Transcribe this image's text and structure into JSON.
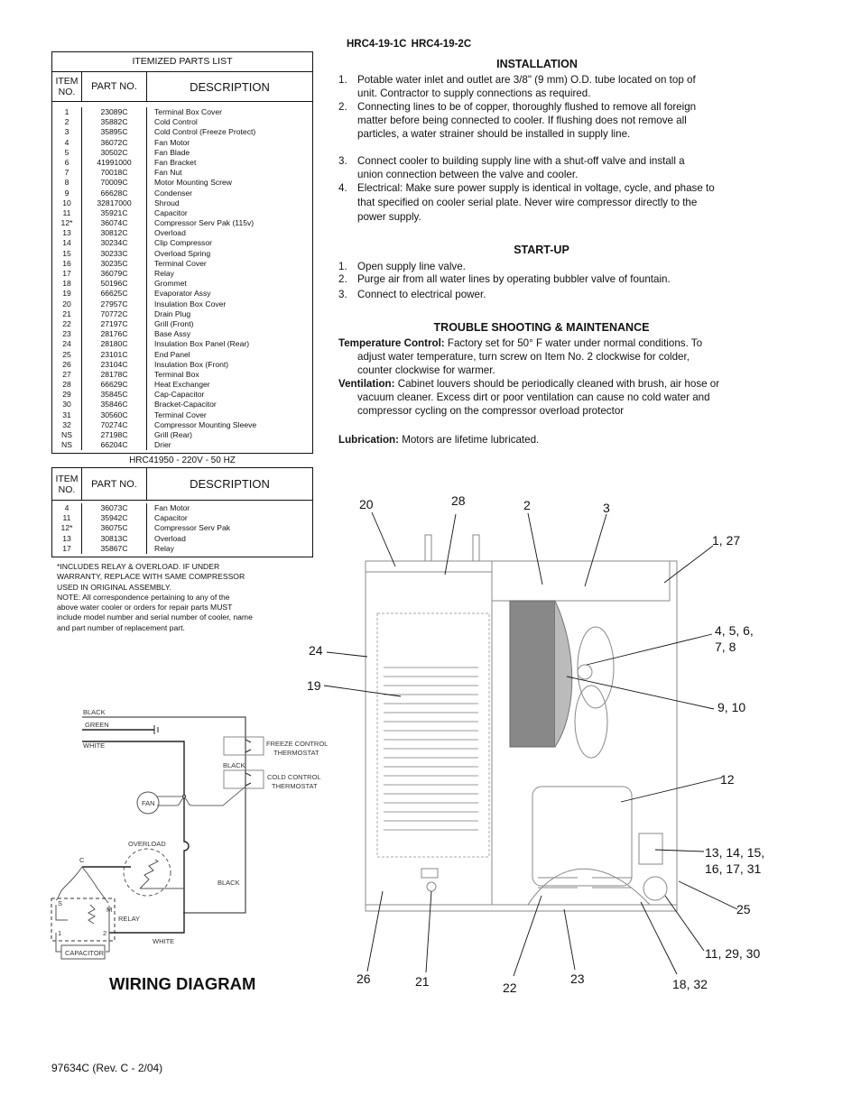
{
  "header": {
    "models": "HRC4-19-1C    HRC4-19-2C"
  },
  "parts_list": {
    "title": "ITEMIZED PARTS LIST",
    "columns": {
      "item": "ITEM NO.",
      "part": "PART  NO.",
      "desc": "DESCRIPTION"
    },
    "rows": [
      {
        "item": "1",
        "part": "23089C",
        "desc": "Terminal Box Cover"
      },
      {
        "item": "2",
        "part": "35882C",
        "desc": "Cold Control"
      },
      {
        "item": "3",
        "part": "35895C",
        "desc": "Cold Control (Freeze Protect)"
      },
      {
        "item": "4",
        "part": "36072C",
        "desc": "Fan Motor"
      },
      {
        "item": "5",
        "part": "30502C",
        "desc": "Fan Blade"
      },
      {
        "item": "6",
        "part": "41991000",
        "desc": "Fan Bracket"
      },
      {
        "item": "7",
        "part": "70018C",
        "desc": "Fan Nut"
      },
      {
        "item": "8",
        "part": "70009C",
        "desc": "Motor Mounting Screw"
      },
      {
        "item": "9",
        "part": "66628C",
        "desc": "Condenser"
      },
      {
        "item": "10",
        "part": "32817000",
        "desc": "Shroud"
      },
      {
        "item": "11",
        "part": "35921C",
        "desc": "Capacitor"
      },
      {
        "item": "12*",
        "part": "36074C",
        "desc": "Compressor Serv Pak (115v)"
      },
      {
        "item": "13",
        "part": "30812C",
        "desc": "Overload"
      },
      {
        "item": "14",
        "part": "30234C",
        "desc": "Clip Compressor"
      },
      {
        "item": "15",
        "part": "30233C",
        "desc": "Overload  Spring"
      },
      {
        "item": "16",
        "part": "30235C",
        "desc": "Terminal Cover"
      },
      {
        "item": "17",
        "part": "36079C",
        "desc": "Relay"
      },
      {
        "item": "18",
        "part": "50196C",
        "desc": "Grommet"
      },
      {
        "item": "19",
        "part": "66625C",
        "desc": "Evaporator Assy"
      },
      {
        "item": "20",
        "part": "27957C",
        "desc": "Insulation  Box Cover"
      },
      {
        "item": "21",
        "part": "70772C",
        "desc": "Drain  Plug"
      },
      {
        "item": "22",
        "part": "27197C",
        "desc": "Grill  (Front)"
      },
      {
        "item": "23",
        "part": "28176C",
        "desc": "Base Assy"
      },
      {
        "item": "24",
        "part": "28180C",
        "desc": "Insulation  Box  Panel  (Rear)"
      },
      {
        "item": "25",
        "part": "23101C",
        "desc": "End  Panel"
      },
      {
        "item": "26",
        "part": "23104C",
        "desc": "Insulation  Box  (Front)"
      },
      {
        "item": "27",
        "part": "28178C",
        "desc": "Terminal Box"
      },
      {
        "item": "28",
        "part": "66629C",
        "desc": "Heat Exchanger"
      },
      {
        "item": "29",
        "part": "35845C",
        "desc": "Cap-Capacitor"
      },
      {
        "item": "30",
        "part": "35846C",
        "desc": "Bracket-Capacitor"
      },
      {
        "item": "31",
        "part": "30560C",
        "desc": "Terminal Cover"
      },
      {
        "item": "32",
        "part": "70274C",
        "desc": "Compressor Mounting Sleeve"
      },
      {
        "item": "NS",
        "part": "27198C",
        "desc": "Grill  (Rear)"
      },
      {
        "item": "NS",
        "part": "66204C",
        "desc": "Drier"
      }
    ]
  },
  "alt_parts_list": {
    "title": "HRC41950 - 220V - 50 HZ",
    "columns": {
      "item": "ITEM NO.",
      "part": "PART  NO.",
      "desc": "DESCRIPTION"
    },
    "rows": [
      {
        "item": "4",
        "part": "36073C",
        "desc": "Fan Motor"
      },
      {
        "item": "11",
        "part": "35942C",
        "desc": "Capacitor"
      },
      {
        "item": "12*",
        "part": "36075C",
        "desc": "Compressor Serv Pak"
      },
      {
        "item": "13",
        "part": "30813C",
        "desc": "Overload"
      },
      {
        "item": "17",
        "part": "35867C",
        "desc": "Relay"
      }
    ]
  },
  "footnote": [
    "*INCLUDES RELAY & OVERLOAD.  IF UNDER",
    "WARRANTY, REPLACE WITH SAME COMPRESSOR",
    "USED IN ORIGINAL ASSEMBLY.",
    "NOTE:  All correspondence pertaining to any of the",
    "above water cooler or orders for repair parts MUST",
    "include model number and serial number of cooler, name",
    "and part number of replacement part."
  ],
  "installation": {
    "heading": "INSTALLATION",
    "items": [
      {
        "num": "1.",
        "text": "Potable water inlet and outlet are 3/8\" (9 mm) O.D. tube located on top of unit.  Contractor to supply connections as required."
      },
      {
        "num": "2.",
        "text": "Connecting lines to be of copper, thoroughly flushed to remove all foreign matter before being connected to cooler.  If flushing does not remove all particles, a water strainer should be installed in supply line."
      },
      {
        "num": "3.",
        "text": "Connect cooler to building supply line with a shut-off valve and install a union connection between the valve and cooler."
      },
      {
        "num": "4.",
        "text": "Electrical: Make sure power supply is identical in voltage, cycle, and phase to that specified on cooler serial plate.  Never wire compressor directly to the power  supply."
      }
    ]
  },
  "startup": {
    "heading": "START-UP",
    "items": [
      {
        "num": "1.",
        "text": "Open supply line valve."
      },
      {
        "num": "2.",
        "text": "Purge air from all water lines by operating bubbler valve of fountain."
      },
      {
        "num": "3.",
        "text": "Connect to electrical power."
      }
    ]
  },
  "maintenance": {
    "heading": "TROUBLE SHOOTING & MAINTENANCE",
    "items": [
      {
        "label": "Temperature Control:",
        "text": " Factory set for 50° F water under normal conditions.  To adjust water temperature, turn screw on Item No. 2 clockwise for colder, counter clockwise for warmer."
      },
      {
        "label": "Ventilation:",
        "text": " Cabinet louvers should be periodically cleaned with brush, air hose or vacuum cleaner.  Excess dirt or poor ventilation can cause no cold water and compressor cycling on the compressor overload protector"
      },
      {
        "label": "Lubrication:",
        "text": " Motors are lifetime lubricated."
      }
    ]
  },
  "wiring": {
    "title": "WIRING DIAGRAM",
    "labels": {
      "black": "BLACK",
      "green": "GREEN",
      "white": "WHITE",
      "freeze1": "FREEZE CONTROL",
      "freeze2": "THERMOSTAT",
      "black2": "BLACK",
      "cold1": "COLD CONTROL",
      "cold2": "THERMOSTAT",
      "fan": "FAN",
      "overload": "OVERLOAD",
      "black3": "BLACK",
      "relay": "RELAY",
      "white2": "WHITE",
      "capacitor": "CAPACITOR",
      "c": "C",
      "s": "S",
      "m": "M",
      "one": "1",
      "two": "2"
    }
  },
  "callouts": [
    "20",
    "28",
    "2",
    "3",
    "1, 27",
    "4, 5, 6,",
    "7, 8",
    "24",
    "19",
    "9, 10",
    "12",
    "13, 14, 15,",
    "16, 17, 31",
    "25",
    "11, 29, 30",
    "26",
    "21",
    "22",
    "23",
    "18, 32"
  ],
  "footer": {
    "doc_number": "97634C (Rev. C - 2/04)"
  }
}
